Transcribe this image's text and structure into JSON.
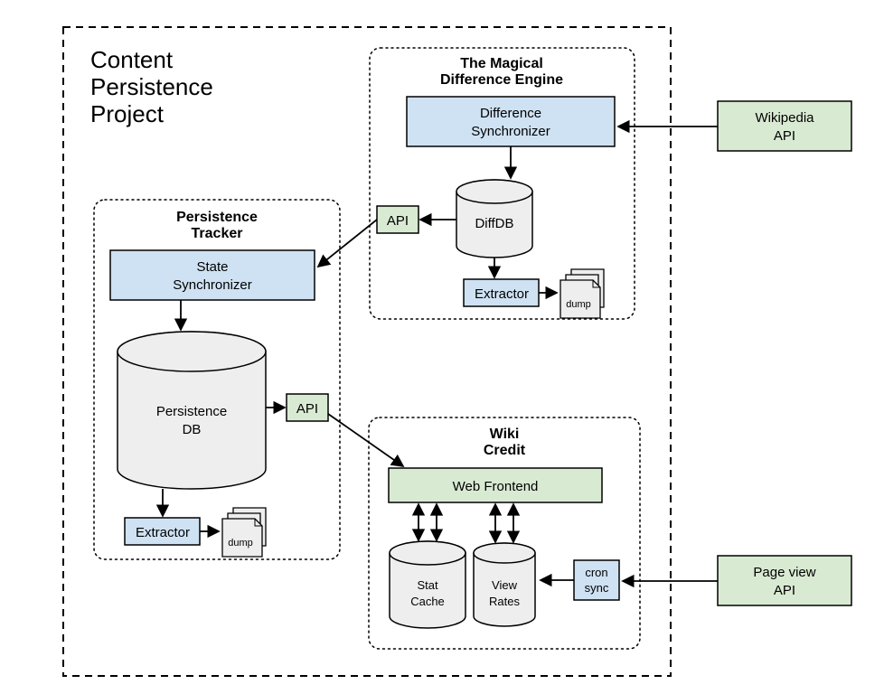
{
  "colors": {
    "blue": "#cfe2f3",
    "green": "#d9ead3",
    "gray": "#eeeeee"
  },
  "outer": {
    "title_line1": "Content",
    "title_line2": "Persistence",
    "title_line3": "Project"
  },
  "magical": {
    "title_line1": "The Magical",
    "title_line2": "Difference Engine",
    "diff_sync_line1": "Difference",
    "diff_sync_line2": "Synchronizer",
    "db_label": "DiffDB",
    "api_label": "API",
    "extractor_label": "Extractor",
    "dump_label": "dump"
  },
  "tracker": {
    "title_line1": "Persistence",
    "title_line2": "Tracker",
    "state_sync_line1": "State",
    "state_sync_line2": "Synchronizer",
    "db_label_line1": "Persistence",
    "db_label_line2": "DB",
    "api_label": "API",
    "extractor_label": "Extractor",
    "dump_label": "dump"
  },
  "wiki": {
    "title_line1": "Wiki",
    "title_line2": "Credit",
    "frontend_label": "Web Frontend",
    "stat_cache_line1": "Stat",
    "stat_cache_line2": "Cache",
    "view_rates_line1": "View",
    "view_rates_line2": "Rates",
    "cron_line1": "cron",
    "cron_line2": "sync"
  },
  "external": {
    "wikipedia_line1": "Wikipedia",
    "wikipedia_line2": "API",
    "pageview_line1": "Page view",
    "pageview_line2": "API"
  }
}
